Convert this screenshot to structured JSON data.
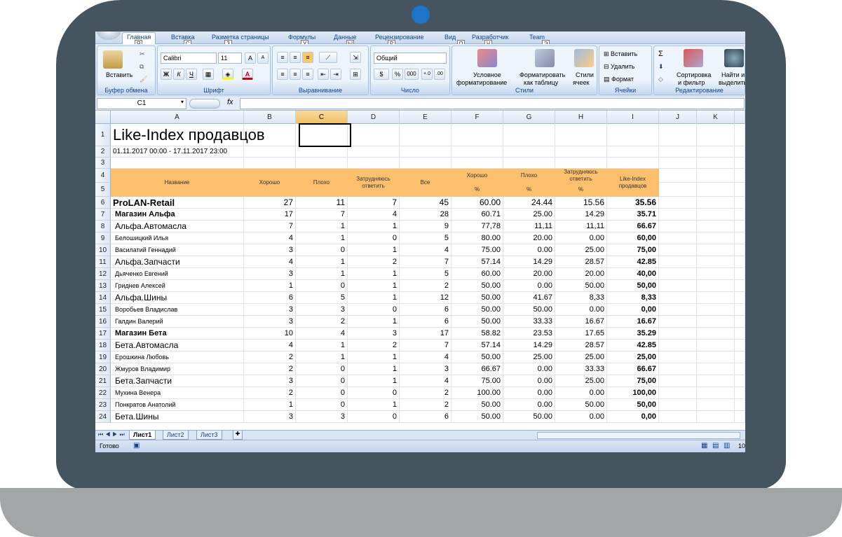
{
  "ribbon": {
    "tabs": [
      {
        "label": "Главная",
        "key": "Я"
      },
      {
        "label": "Вставка",
        "key": "С"
      },
      {
        "label": "Разметка страницы",
        "key": "З"
      },
      {
        "label": "Формулы",
        "key": "У"
      },
      {
        "label": "Данные",
        "key": "Ы"
      },
      {
        "label": "Рецензирование",
        "key": "Р"
      },
      {
        "label": "Вид",
        "key": "О"
      },
      {
        "label": "Разработчик",
        "key": "Ч"
      },
      {
        "label": "Team",
        "key": "Э"
      }
    ],
    "clipboard": {
      "paste": "Вставить",
      "label": "Буфер обмена"
    },
    "font": {
      "name": "Calibri",
      "size": "11",
      "label": "Шрифт",
      "grow": "A",
      "shrink": "A",
      "bold": "Ж",
      "italic": "К",
      "underline": "Ч",
      "color": "A"
    },
    "align": {
      "label": "Выравнивание"
    },
    "number": {
      "format": "Общий",
      "label": "Число",
      "percent": "%",
      "thousands": "000"
    },
    "styles": {
      "cond1": "Условное",
      "cond2": "форматирование",
      "table1": "Форматировать",
      "table2": "как таблицу",
      "cell1": "Стили",
      "cell2": "ячеек",
      "label": "Стили"
    },
    "cells": {
      "insert": "Вставить",
      "delete": "Удалить",
      "format": "Формат",
      "label": "Ячейки"
    },
    "editing": {
      "sum": "Σ",
      "sort1": "Сортировка",
      "sort2": "и фильтр",
      "find1": "Найти и",
      "find2": "выделить",
      "label": "Редактирование"
    }
  },
  "formula_bar": {
    "cell": "C1",
    "fx": "fx",
    "value": ""
  },
  "columns": [
    "A",
    "B",
    "C",
    "D",
    "E",
    "F",
    "G",
    "H",
    "I",
    "J",
    "K"
  ],
  "sheet": {
    "title": "Like-Index продавцов",
    "period": "01.11.2017 00:00 - 17.11.2017 23:00",
    "headers": {
      "name": "Название",
      "good": "Хорошо",
      "bad": "Плохо",
      "hard": "Затрудняюсь ответить",
      "all": "Все",
      "good_pct": "Хорошо",
      "bad_pct": "Плохо",
      "hard_pct": "Затрудняюсь ответить",
      "index": "Like-Index продавцов",
      "pct": "%"
    },
    "data": [
      {
        "r": "6",
        "name": "ProLAN-Retail",
        "b": "27",
        "c": "11",
        "d": "7",
        "e": "45",
        "f": "60.00",
        "g": "24.44",
        "h": "15.56",
        "i": "35.56",
        "style": "top"
      },
      {
        "r": "7",
        "name": "Магазин Альфа",
        "b": "17",
        "c": "7",
        "d": "4",
        "e": "28",
        "f": "60.71",
        "g": "25.00",
        "h": "14.29",
        "i": "35.71",
        "style": "store"
      },
      {
        "r": "8",
        "name": "Альфа.Автомасла",
        "b": "7",
        "c": "1",
        "d": "1",
        "e": "9",
        "f": "77,78",
        "g": "11,11",
        "h": "11,11",
        "i": "66.67",
        "style": "dept"
      },
      {
        "r": "9",
        "name": "Белошицкий Илья",
        "b": "4",
        "c": "1",
        "d": "0",
        "e": "5",
        "f": "80.00",
        "g": "20.00",
        "h": "0.00",
        "i": "60,00",
        "style": "person"
      },
      {
        "r": "10",
        "name": "Василатий Геннадий",
        "b": "3",
        "c": "0",
        "d": "1",
        "e": "4",
        "f": "75.00",
        "g": "0.00",
        "h": "25.00",
        "i": "75,00",
        "style": "person"
      },
      {
        "r": "11",
        "name": "Альфа.Запчасти",
        "b": "4",
        "c": "1",
        "d": "2",
        "e": "7",
        "f": "57.14",
        "g": "14.29",
        "h": "28.57",
        "i": "42.85",
        "style": "dept"
      },
      {
        "r": "12",
        "name": "Дьяченко Евгений",
        "b": "3",
        "c": "1",
        "d": "1",
        "e": "5",
        "f": "60.00",
        "g": "20.00",
        "h": "20.00",
        "i": "40,00",
        "style": "person"
      },
      {
        "r": "13",
        "name": "Гриднев Алексей",
        "b": "1",
        "c": "0",
        "d": "1",
        "e": "2",
        "f": "50.00",
        "g": "0.00",
        "h": "50.00",
        "i": "50,00",
        "style": "person"
      },
      {
        "r": "14",
        "name": "Альфа.Шины",
        "b": "6",
        "c": "5",
        "d": "1",
        "e": "12",
        "f": "50.00",
        "g": "41.67",
        "h": "8,33",
        "i": "8,33",
        "style": "dept"
      },
      {
        "r": "15",
        "name": "Воробьев Владислав",
        "b": "3",
        "c": "3",
        "d": "0",
        "e": "6",
        "f": "50.00",
        "g": "50.00",
        "h": "0.00",
        "i": "0,00",
        "style": "person"
      },
      {
        "r": "16",
        "name": "Галдин Валерий",
        "b": "3",
        "c": "2",
        "d": "1",
        "e": "6",
        "f": "50.00",
        "g": "33.33",
        "h": "16.67",
        "i": "16.67",
        "style": "person"
      },
      {
        "r": "17",
        "name": "Магазин Бета",
        "b": "10",
        "c": "4",
        "d": "3",
        "e": "17",
        "f": "58.82",
        "g": "23.53",
        "h": "17.65",
        "i": "35.29",
        "style": "store"
      },
      {
        "r": "18",
        "name": "Бета.Автомасла",
        "b": "4",
        "c": "1",
        "d": "2",
        "e": "7",
        "f": "57.14",
        "g": "14.29",
        "h": "28.57",
        "i": "42.85",
        "style": "dept"
      },
      {
        "r": "19",
        "name": "Ерошкина Любовь",
        "b": "2",
        "c": "1",
        "d": "1",
        "e": "4",
        "f": "50.00",
        "g": "25.00",
        "h": "25.00",
        "i": "25,00",
        "style": "person"
      },
      {
        "r": "20",
        "name": "Жмуров Владимир",
        "b": "2",
        "c": "0",
        "d": "1",
        "e": "3",
        "f": "66.67",
        "g": "0.00",
        "h": "33.33",
        "i": "66.67",
        "style": "person"
      },
      {
        "r": "21",
        "name": "Бета.Запчасти",
        "b": "3",
        "c": "0",
        "d": "1",
        "e": "4",
        "f": "75.00",
        "g": "0.00",
        "h": "25.00",
        "i": "75,00",
        "style": "dept"
      },
      {
        "r": "22",
        "name": "Мухина Венера",
        "b": "2",
        "c": "0",
        "d": "0",
        "e": "2",
        "f": "100.00",
        "g": "0.00",
        "h": "0.00",
        "i": "100,00",
        "style": "person"
      },
      {
        "r": "23",
        "name": "Понкратов Анатолий",
        "b": "1",
        "c": "0",
        "d": "1",
        "e": "2",
        "f": "50.00",
        "g": "0.00",
        "h": "50.00",
        "i": "50,00",
        "style": "person"
      },
      {
        "r": "24",
        "name": "Бета.Шины",
        "b": "3",
        "c": "3",
        "d": "0",
        "e": "6",
        "f": "50.00",
        "g": "50.00",
        "h": "0.00",
        "i": "0,00",
        "style": "dept"
      }
    ]
  },
  "sheet_tabs": [
    "Лист1",
    "Лист2",
    "Лист3"
  ],
  "status": {
    "ready": "Готово",
    "zoom": "10"
  },
  "colors": {
    "header_orange": "#fcbf6e",
    "frame": "#455560",
    "camera": "#1e74c9",
    "base": "#a3a6a6"
  }
}
